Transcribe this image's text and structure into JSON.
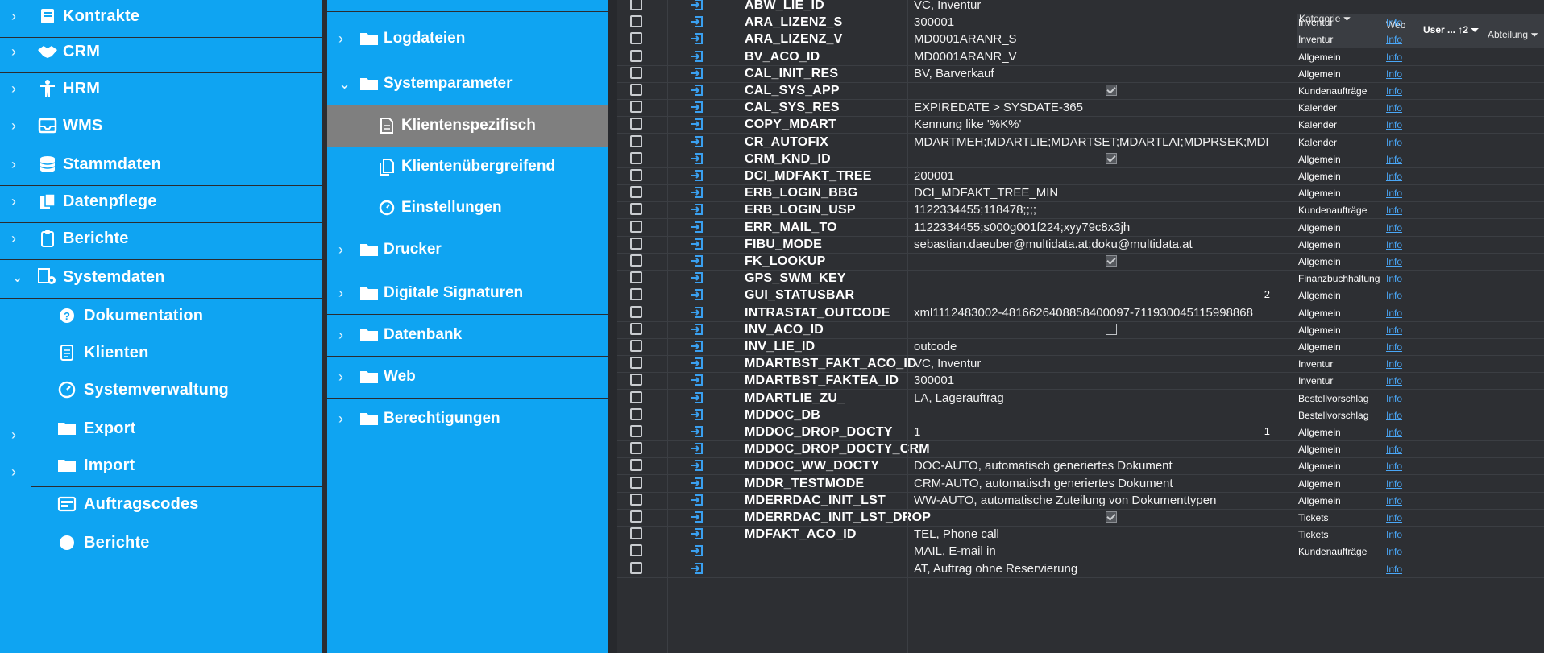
{
  "nav": {
    "items": [
      {
        "label": "Kontrakte",
        "chev": "›",
        "icon": "contract-icon"
      },
      {
        "label": "CRM",
        "chev": "›",
        "icon": "handshake-icon"
      },
      {
        "label": "HRM",
        "chev": "›",
        "icon": "person-icon"
      },
      {
        "label": "WMS",
        "chev": "›",
        "icon": "inbox-icon"
      },
      {
        "label": "Stammdaten",
        "chev": "›",
        "icon": "database-icon"
      },
      {
        "label": "Datenpflege",
        "chev": "›",
        "icon": "files-icon"
      },
      {
        "label": "Berichte",
        "chev": "›",
        "icon": "clipboard-icon"
      },
      {
        "label": "Systemdaten",
        "chev": "⌄",
        "icon": "system-gear-icon"
      }
    ],
    "sub_items": [
      {
        "label": "Dokumentation",
        "icon": "help-icon"
      },
      {
        "label": "Klienten",
        "icon": "document-icon"
      },
      {
        "label": "Systemverwaltung",
        "icon": "dashboard-icon"
      },
      {
        "label": "Export",
        "icon": "folder-icon"
      },
      {
        "label": "Import",
        "icon": "folder-icon"
      },
      {
        "label": "Auftragscodes",
        "icon": "codes-icon"
      },
      {
        "label": "Berichte",
        "icon": "report-icon"
      }
    ]
  },
  "tree": {
    "items": [
      {
        "label": "Logdateien",
        "chev": "›"
      },
      {
        "label": "Systemparameter",
        "chev": "⌄"
      },
      {
        "label": "Klientenspezifisch",
        "leaf": true,
        "icon": "doc-icon"
      },
      {
        "label": "Klientenübergreifend",
        "leaf": true,
        "icon": "docs-icon"
      },
      {
        "label": "Einstellungen",
        "leaf": true,
        "icon": "gauge-icon"
      },
      {
        "label": "Drucker",
        "chev": "›"
      },
      {
        "label": "Digitale Signaturen",
        "chev": "›"
      },
      {
        "label": "Datenbank",
        "chev": "›"
      },
      {
        "label": "Web",
        "chev": "›"
      },
      {
        "label": "Berechtigungen",
        "chev": "›"
      }
    ]
  },
  "grid": {
    "headers": {
      "kategorie": "Kategorie",
      "web": "Web",
      "user": "User ...",
      "user_sort": "↑2",
      "abteilung": "Abteilung"
    },
    "link_label": "Info",
    "rows": [
      {
        "key": "ABW_LIE_ID",
        "value": "VC, Inventur",
        "kategorie": "",
        "web": false
      },
      {
        "key": "ARA_LIZENZ_S",
        "value": "300001",
        "kategorie": "Inventur",
        "web": true
      },
      {
        "key": "ARA_LIZENZ_V",
        "value": "MD0001ARANR_S",
        "kategorie": "Inventur",
        "web": true
      },
      {
        "key": "BV_ACO_ID",
        "value": "MD0001ARANR_V",
        "kategorie": "Allgemein",
        "web": true
      },
      {
        "key": "CAL_INIT_RES",
        "value": "BV, Barverkauf",
        "kategorie": "Allgemein",
        "web": true
      },
      {
        "key": "CAL_SYS_APP",
        "value": "",
        "check": "on",
        "kategorie": "Kundenaufträge",
        "web": true
      },
      {
        "key": "CAL_SYS_RES",
        "value": "EXPIREDATE > SYSDATE-365",
        "kategorie": "Kalender",
        "web": true
      },
      {
        "key": "COPY_MDART",
        "value": "Kennung like '%K%'",
        "kategorie": "Kalender",
        "web": true
      },
      {
        "key": "CR_AUTOFIX",
        "value": "MDARTMEH;MDARTLIE;MDARTSET;MDARTLAI;MDPRSEK;MDPRSVK;MDARTSPR;",
        "kategorie": "Kalender",
        "web": true
      },
      {
        "key": "CRM_KND_ID",
        "value": "",
        "check": "on",
        "kategorie": "Allgemein",
        "web": true
      },
      {
        "key": "DCI_MDFAKT_TREE",
        "value": "200001",
        "kategorie": "Allgemein",
        "web": true
      },
      {
        "key": "ERB_LOGIN_BBG",
        "value": "DCI_MDFAKT_TREE_MIN",
        "kategorie": "Allgemein",
        "web": true
      },
      {
        "key": "ERB_LOGIN_USP",
        "value": "1122334455;118478;;;;",
        "kategorie": "Kundenaufträge",
        "web": true
      },
      {
        "key": "ERR_MAIL_TO",
        "value": "1122334455;s000g001f224;xyy79c8x3jh",
        "kategorie": "Allgemein",
        "web": true
      },
      {
        "key": "FIBU_MODE",
        "value": "sebastian.daeuber@multidata.at;doku@multidata.at",
        "kategorie": "Allgemein",
        "web": true
      },
      {
        "key": "FK_LOOKUP",
        "value": "",
        "check": "on",
        "kategorie": "Allgemein",
        "web": true
      },
      {
        "key": "GPS_SWM_KEY",
        "value": "",
        "kategorie": "Finanzbuchhaltung",
        "web": true
      },
      {
        "key": "GUI_STATUSBAR",
        "value": "",
        "num": "2",
        "kategorie": "Allgemein",
        "web": true
      },
      {
        "key": "INTRASTAT_OUTCODE",
        "value": "xml1112483002-4816626408858400097-711930045115998868",
        "kategorie": "Allgemein",
        "web": true
      },
      {
        "key": "INV_ACO_ID",
        "value": "",
        "check": "off",
        "kategorie": "Allgemein",
        "web": true
      },
      {
        "key": "INV_LIE_ID",
        "value": "outcode",
        "kategorie": "Allgemein",
        "web": true
      },
      {
        "key": "MDARTBST_FAKT_ACO_ID",
        "value": "VC, Inventur",
        "kategorie": "Inventur",
        "web": true
      },
      {
        "key": "MDARTBST_FAKTEA_ID",
        "value": "300001",
        "kategorie": "Inventur",
        "web": true
      },
      {
        "key": "MDARTLIE_ZU_",
        "value": "LA, Lagerauftrag",
        "kategorie": "Bestellvorschlag",
        "web": true
      },
      {
        "key": "MDDOC_DB",
        "value": "",
        "kategorie": "Bestellvorschlag",
        "web": true
      },
      {
        "key": "MDDOC_DROP_DOCTY",
        "value": "1",
        "num": "1",
        "kategorie": "Allgemein",
        "web": true
      },
      {
        "key": "MDDOC_DROP_DOCTY_CRM",
        "value": "",
        "kategorie": "Allgemein",
        "web": true
      },
      {
        "key": "MDDOC_WW_DOCTY",
        "value": "DOC-AUTO, automatisch generiertes Dokument",
        "kategorie": "Allgemein",
        "web": true
      },
      {
        "key": "MDDR_TESTMODE",
        "value": "CRM-AUTO, automatisch generiertes Dokument",
        "kategorie": "Allgemein",
        "web": true
      },
      {
        "key": "MDERRDAC_INIT_LST",
        "value": "WW-AUTO, automatische Zuteilung von Dokumenttypen",
        "kategorie": "Allgemein",
        "web": true
      },
      {
        "key": "MDERRDAC_INIT_LST_DROP",
        "value": "",
        "check": "on",
        "kategorie": "Tickets",
        "web": true
      },
      {
        "key": "MDFAKT_ACO_ID",
        "value": "TEL, Phone call",
        "kategorie": "Tickets",
        "web": true
      },
      {
        "key": "",
        "value": "MAIL, E-mail in",
        "kategorie": "Kundenaufträge",
        "web": true
      },
      {
        "key": "",
        "value": "AT, Auftrag ohne Reservierung",
        "kategorie": "",
        "web": true
      }
    ]
  },
  "colors": {
    "accent": "#0fa4f2",
    "selected": "#7f7f7f",
    "grid_bg": "#2d2f33",
    "link": "#4aa7f7"
  }
}
